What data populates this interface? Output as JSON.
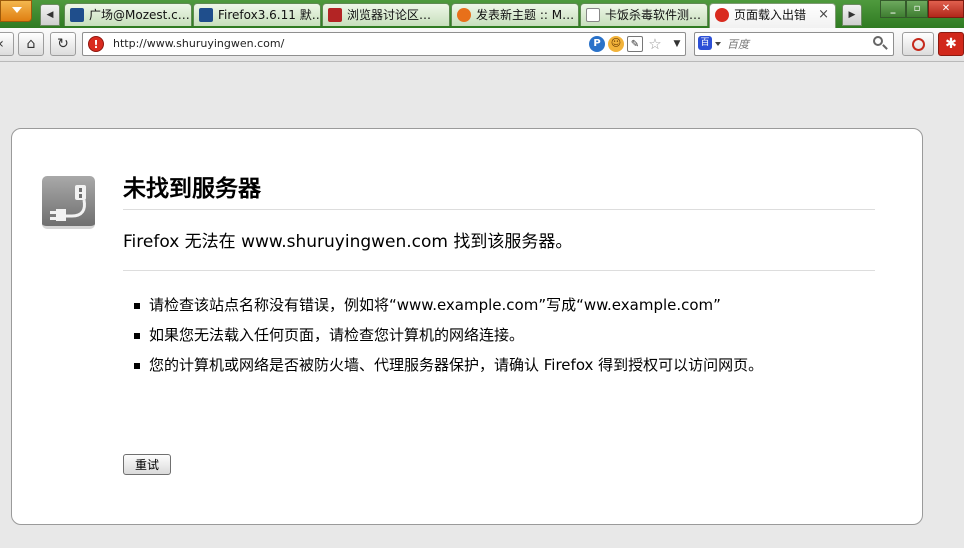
{
  "tabs": [
    {
      "title": "广场@Mozest.c…",
      "favicon_color": "#1f4e8c"
    },
    {
      "title": "Firefox3.6.11 默…",
      "favicon_color": "#1f4e8c"
    },
    {
      "title": "浏览器讨论区…",
      "favicon_color": "#b32424"
    },
    {
      "title": "发表新主题 :: M…",
      "favicon_color": "#e8701a"
    },
    {
      "title": "卡饭杀毒软件测…",
      "favicon_color": "#ffffff"
    },
    {
      "title": "页面载入出错",
      "favicon_color": "#d92b1f",
      "active": true
    }
  ],
  "tab_close": "×",
  "nav": {
    "back": "‹",
    "home": "⌂",
    "reload": "↻",
    "url": "http://www.shuruyingwen.com/",
    "search_placeholder": "百度",
    "search_engine_label": "百"
  },
  "error": {
    "title": "未找到服务器",
    "short_desc": "Firefox  无法在 www.shuruyingwen.com 找到该服务器。",
    "suggestions": [
      "请检查该站点名称没有错误，例如将“www.example.com”写成“ww.example.com”",
      "如果您无法载入任何页面，请检查您计算机的网络连接。",
      "您的计算机或网络是否被防火墙、代理服务器保护，请确认 Firefox 得到授权可以访问网页。"
    ],
    "retry_label": "重试"
  }
}
